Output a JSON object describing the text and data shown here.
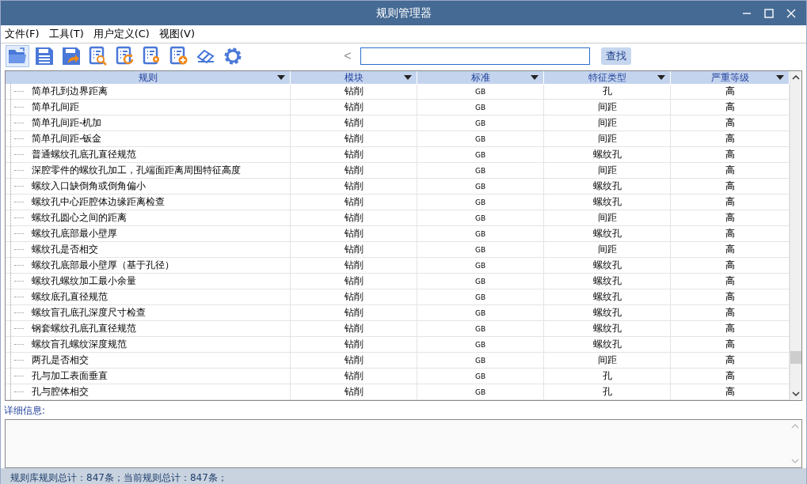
{
  "window": {
    "title": "规则管理器"
  },
  "menu": [
    {
      "label": "文件(F)"
    },
    {
      "label": "工具(T)"
    },
    {
      "label": "用户定义(C)"
    },
    {
      "label": "视图(V)"
    }
  ],
  "toolbar": [
    {
      "kind": "open",
      "pressed": true
    },
    {
      "kind": "save",
      "pressed": false
    },
    {
      "kind": "save-as",
      "pressed": false
    },
    {
      "kind": "search-doc",
      "pressed": false
    },
    {
      "kind": "refresh-doc",
      "pressed": false
    },
    {
      "kind": "gear-doc",
      "pressed": false
    },
    {
      "kind": "add-doc",
      "pressed": false
    },
    {
      "kind": "eraser",
      "pressed": false
    },
    {
      "kind": "settings",
      "pressed": false
    }
  ],
  "search": {
    "back": "<",
    "button": "查找"
  },
  "table": {
    "columns": [
      "规则",
      "模块",
      "标准",
      "特征类型",
      "严重等级"
    ],
    "rows": [
      [
        "简单孔到边界距离",
        "钻削",
        "GB",
        "孔",
        "高"
      ],
      [
        "简单孔间距",
        "钻削",
        "GB",
        "间距",
        "高"
      ],
      [
        "简单孔间距-机加",
        "钻削",
        "GB",
        "间距",
        "高"
      ],
      [
        "简单孔间距-钣金",
        "钻削",
        "GB",
        "间距",
        "高"
      ],
      [
        "普通螺纹孔底孔直径规范",
        "钻削",
        "GB",
        "螺纹孔",
        "高"
      ],
      [
        "深腔零件的螺纹孔加工，孔端面距离周围特征高度",
        "钻削",
        "GB",
        "间距",
        "高"
      ],
      [
        "螺纹入口缺倒角或倒角偏小",
        "钻削",
        "GB",
        "螺纹孔",
        "高"
      ],
      [
        "螺纹孔中心距腔体边缘距离检查",
        "钻削",
        "GB",
        "螺纹孔",
        "高"
      ],
      [
        "螺纹孔圆心之间的距离",
        "钻削",
        "GB",
        "间距",
        "高"
      ],
      [
        "螺纹孔底部最小壁厚",
        "钻削",
        "GB",
        "螺纹孔",
        "高"
      ],
      [
        "螺纹孔是否相交",
        "钻削",
        "GB",
        "间距",
        "高"
      ],
      [
        "螺纹孔底部最小壁厚（基于孔径）",
        "钻削",
        "GB",
        "螺纹孔",
        "高"
      ],
      [
        "螺纹孔螺纹加工最小余量",
        "钻削",
        "GB",
        "螺纹孔",
        "高"
      ],
      [
        "螺纹底孔直径规范",
        "钻削",
        "GB",
        "螺纹孔",
        "高"
      ],
      [
        "螺纹盲孔底孔深度尺寸检查",
        "钻削",
        "GB",
        "螺纹孔",
        "高"
      ],
      [
        "钢套螺纹孔底孔直径规范",
        "钻削",
        "GB",
        "螺纹孔",
        "高"
      ],
      [
        "螺纹盲孔螺纹深度规范",
        "钻削",
        "GB",
        "螺纹孔",
        "高"
      ],
      [
        "两孔是否相交",
        "钻削",
        "GB",
        "间距",
        "高"
      ],
      [
        "孔与加工表面垂直",
        "钻削",
        "GB",
        "孔",
        "高"
      ],
      [
        "孔与腔体相交",
        "钻削",
        "GB",
        "孔",
        "高"
      ]
    ]
  },
  "details": {
    "label": "详细信息:"
  },
  "status_bar": "规则库规则总计：847条；当前规则总计：847条；"
}
